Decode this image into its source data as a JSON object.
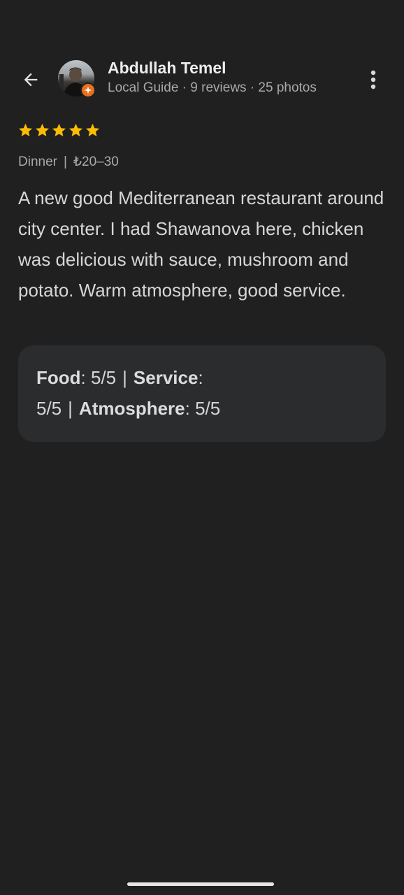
{
  "header": {
    "user_name": "Abdullah Temel",
    "meta": "Local Guide · 9 reviews · 25 photos"
  },
  "review": {
    "rating": 5,
    "max_rating": 5,
    "meal_type": "Dinner",
    "separator": "|",
    "price_range": "₺20–30",
    "text": "A new good Mediterranean restaurant around city center. I had Shawanova here, chicken was delicious with sauce, mushroom and potato. Warm atmosphere, good service."
  },
  "ratings": {
    "food_label": "Food",
    "food_value": "5/5",
    "service_label": "Service",
    "service_value": "5/5",
    "atmosphere_label": "Atmosphere",
    "atmosphere_value": "5/5",
    "separator": "|"
  },
  "icons": {
    "back": "arrow-back-icon",
    "more": "more-vert-icon",
    "star": "star-icon",
    "badge": "local-guide-badge-icon"
  },
  "colors": {
    "background": "#202020",
    "star": "#fbbc04",
    "badge": "#e8711d",
    "card": "#2b2c2e"
  }
}
